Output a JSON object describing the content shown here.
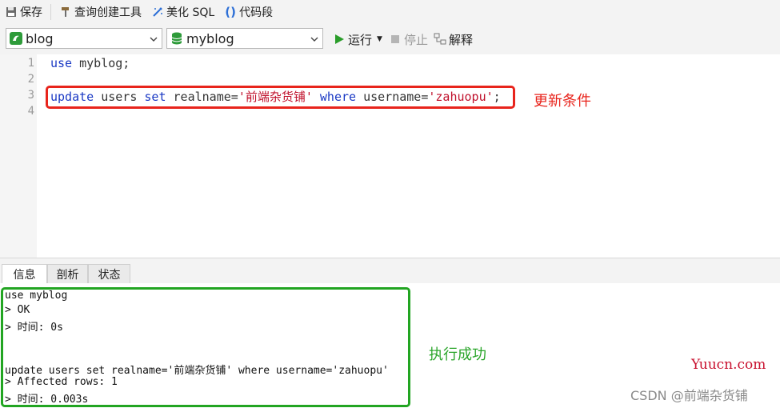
{
  "toolbar": {
    "save_label": "保存",
    "query_builder_label": "查询创建工具",
    "beautify_sql_label": "美化 SQL",
    "code_snippet_label": "代码段"
  },
  "connection_select": {
    "value": "blog"
  },
  "database_select": {
    "value": "myblog"
  },
  "run_label": "运行",
  "stop_label": "停止",
  "explain_label": "解释",
  "editor": {
    "line_numbers": [
      "1",
      "2",
      "3",
      "4"
    ],
    "line1": {
      "kw": "use",
      "rest": " myblog;"
    },
    "line3": {
      "t1": "update",
      "t2": " users ",
      "t3": "set",
      "t4": " realname=",
      "t5": "'前端杂货铺'",
      "t6": " ",
      "t7": "where",
      "t8": " username=",
      "t9": "'zahuopu'",
      "t10": ";"
    }
  },
  "annotations": {
    "update_condition": "更新条件",
    "success": "执行成功"
  },
  "tabs": [
    {
      "label": "信息",
      "active": true
    },
    {
      "label": "剖析",
      "active": false
    },
    {
      "label": "状态",
      "active": false
    }
  ],
  "output_lines": [
    "use myblog",
    "> OK",
    "> 时间: 0s",
    "",
    "",
    "update users set realname='前端杂货铺' where username='zahuopu'",
    "> Affected rows: 1",
    "> 时间: 0.003s"
  ],
  "watermarks": {
    "site": "Yuucn.com",
    "csdn": "CSDN @前端杂货铺"
  },
  "colors": {
    "keyword": "#1a39c4",
    "string": "#c0112c",
    "highlight_red": "#e8241c",
    "highlight_green": "#22a522",
    "run_green": "#2a9d2a"
  },
  "icons": [
    "save-icon",
    "hammer-icon",
    "magic-wand-icon",
    "braces-icon",
    "connection-icon",
    "database-icon",
    "play-icon",
    "stop-icon",
    "explain-icon",
    "chevron-down-icon"
  ]
}
